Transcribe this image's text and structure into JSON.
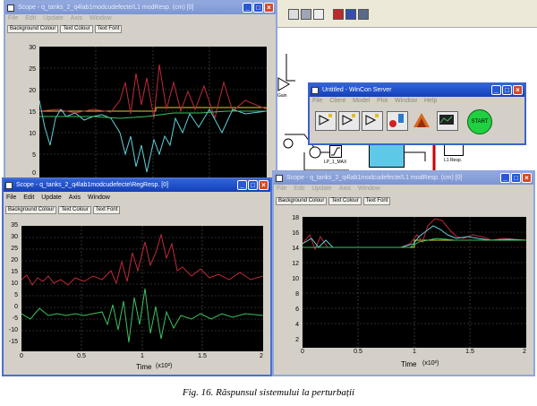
{
  "background_app": {
    "toolbar_icons": [
      "lib-icon",
      "save-icon",
      "print-icon",
      "build-icon",
      "debug-icon",
      "model-icon"
    ],
    "sim_blocks": [
      {
        "id": "gain",
        "label": "Gain"
      },
      {
        "id": "lpmax",
        "label": "LP_1_MAX"
      },
      {
        "id": "l1resp",
        "label": "L1 Resp."
      }
    ],
    "wincon": {
      "title": "Untitled - WinCon Server",
      "menu": [
        "File",
        "Client",
        "Model",
        "Plot",
        "Window",
        "Help"
      ],
      "start_label": "START"
    }
  },
  "windows": [
    {
      "id": "scope1",
      "title": "Scope - q_tanks_2_q4lab1modcudefecte/L1 modResp. (cm) [0]",
      "menu": [
        "File",
        "Edit",
        "Update",
        "Axis",
        "Window"
      ],
      "tabs": [
        "Background Colour",
        "Text Colour",
        "Text Font"
      ],
      "y_ticks": [
        "30",
        "25",
        "20",
        "15",
        "10",
        "5",
        "0"
      ],
      "x_ticks": [],
      "xlabel": "",
      "x_multiplier": ""
    },
    {
      "id": "scope2",
      "title": "Scope - q_tanks_2_q4lab1modcudefecte\\RegResp. [0]",
      "menu": [
        "File",
        "Edit",
        "Update",
        "Axis",
        "Window"
      ],
      "tabs": [
        "Background Colour",
        "Text Colour",
        "Text Font"
      ],
      "y_ticks": [
        "35",
        "30",
        "25",
        "20",
        "15",
        "10",
        "5",
        "0",
        "-5",
        "-10",
        "-15"
      ],
      "x_ticks": [
        "0",
        "0.5",
        "1",
        "1.5",
        "2"
      ],
      "xlabel": "Time",
      "x_multiplier": "(x10²)"
    },
    {
      "id": "scope3",
      "title": "Scope - q_tanks_2_q4lab1modcudefecte/L1 modResp. (cm) [0]",
      "menu": [
        "File",
        "Edit",
        "Update",
        "Axis",
        "Window"
      ],
      "tabs": [
        "Background Colour",
        "Text Colour",
        "Text Font"
      ],
      "y_ticks": [
        "18",
        "16",
        "14",
        "12",
        "10",
        "8",
        "6",
        "4",
        "2"
      ],
      "x_ticks": [
        "0",
        "0.5",
        "1",
        "1.5",
        "2"
      ],
      "xlabel": "Time",
      "x_multiplier": "(x10²)"
    }
  ],
  "caption": "Fig. 16. Răspunsul sistemului la perturbații",
  "colors": {
    "title_active": "#1f4fc8",
    "plot_bg": "#000000",
    "trace_red": "#c02a3a",
    "trace_cyan": "#5fd0d8",
    "trace_green": "#3cc060"
  }
}
